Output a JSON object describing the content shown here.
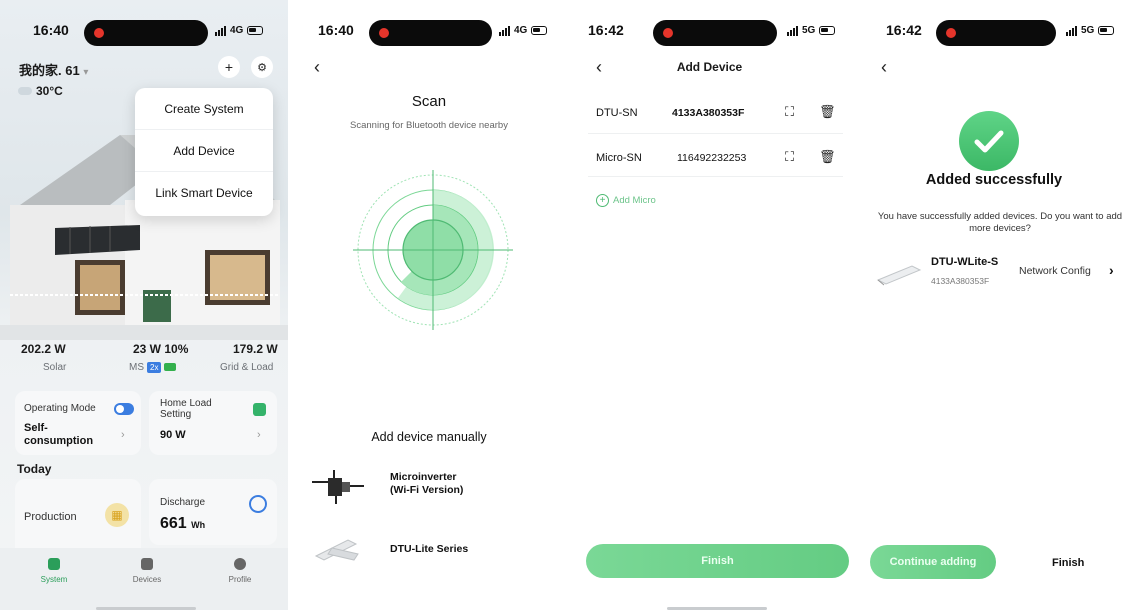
{
  "screens": [
    {
      "status": {
        "time": "16:40",
        "network": "4G"
      },
      "home_name": "我的家. 61",
      "temperature": "30°C",
      "menu": [
        "Create System",
        "Add Device",
        "Link Smart Device"
      ],
      "stats": {
        "solar_value": "202.2 W",
        "solar_label": "Solar",
        "ms_value": "23 W 10%",
        "ms_label": "MS",
        "ms_badge": "2x",
        "grid_value": "179.2 W",
        "grid_label": "Grid & Load"
      },
      "cards": {
        "operating_mode_label": "Operating Mode",
        "operating_mode_value": "Self-consumption",
        "home_load_label": "Home Load Setting",
        "home_load_value": "90 W",
        "today_label": "Today",
        "production_label": "Production",
        "discharge_label": "Discharge",
        "discharge_value": "661",
        "discharge_unit": "Wh"
      },
      "tabs": [
        "System",
        "Devices",
        "Profile"
      ]
    },
    {
      "status": {
        "time": "16:40",
        "network": "4G"
      },
      "title": "Scan",
      "subtitle": "Scanning for Bluetooth device nearby",
      "manual_title": "Add device manually",
      "devices": [
        "Microinverter\n(Wi-Fi Version)",
        "DTU-Lite Series"
      ]
    },
    {
      "status": {
        "time": "16:42",
        "network": "5G"
      },
      "title": "Add Device",
      "rows": [
        {
          "label": "DTU-SN",
          "value": "4133A380353F"
        },
        {
          "label": "Micro-SN",
          "value": "116492232253"
        }
      ],
      "add_micro": "Add Micro",
      "finish_label": "Finish"
    },
    {
      "status": {
        "time": "16:42",
        "network": "5G"
      },
      "title": "Added successfully",
      "message": "You have successfully added devices. Do you want to add more devices?",
      "device_name": "DTU-WLite-S",
      "device_sn": "4133A380353F",
      "network_config": "Network Config",
      "continue_label": "Continue adding",
      "finish_label": "Finish"
    }
  ],
  "colors": {
    "accent_green": "#4fba73",
    "button_green": "#6ccf89",
    "accent_blue": "#3b7de0",
    "record_red": "#e5352b"
  }
}
